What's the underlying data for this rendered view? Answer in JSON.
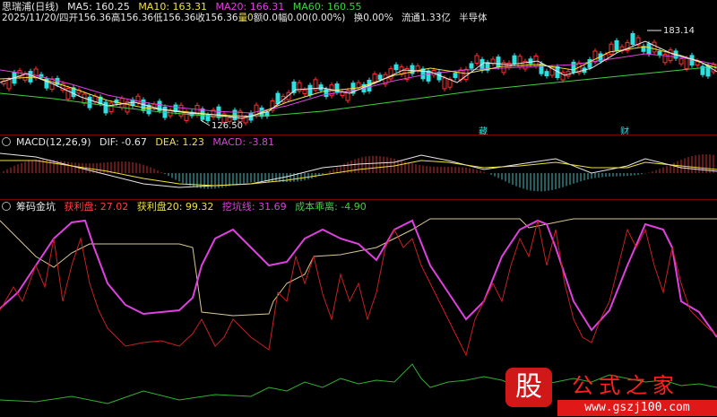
{
  "header": {
    "title": "思瑞浦(日线)",
    "ma5": "MA5: 160.25",
    "ma10": "MA10: 163.31",
    "ma20": "MA20: 166.31",
    "ma60": "MA60: 160.55"
  },
  "quote": {
    "date": "2025/11/20/四",
    "open": "开156.36",
    "high": "高156.36",
    "low": "低156.36",
    "close": "收156.36",
    "vol": "量0",
    "amount": "额0.0",
    "change": "幅0.00(0.00%)",
    "turnover": "换0.00%",
    "float": "流通1.33亿",
    "sector": "半导体"
  },
  "price_panel": {
    "high_marker": "183.14",
    "low_marker": "126.50",
    "tag1": "藏",
    "tag2": "财"
  },
  "macd": {
    "label": "MACD(12,26,9)",
    "dif": "DIF: -0.67",
    "dea": "DEA: 1.23",
    "macd": "MACD: -3.81"
  },
  "chip": {
    "label": "筹码金坑",
    "profit": "获利盘: 27.02",
    "profit20": "获利盘20: 99.32",
    "resist": "挖坑线: 31.69",
    "cost": "成本乖离: -4.90"
  },
  "watermark": {
    "glyph": "股",
    "title": "公式之家",
    "url": "www.gszj100.com"
  },
  "colors": {
    "up": "#ff3030",
    "down": "#30e0e0",
    "ma5": "#e8e8e8",
    "ma10": "#f0e040",
    "ma20": "#e040e0",
    "ma60": "#40d040"
  }
}
